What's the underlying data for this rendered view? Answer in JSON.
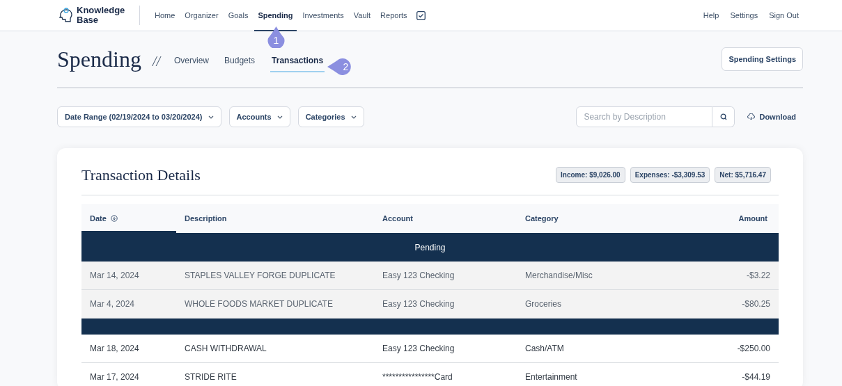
{
  "brand": {
    "name": "Knowledge Base"
  },
  "nav": {
    "items": [
      {
        "label": "Home",
        "selected": false
      },
      {
        "label": "Organizer",
        "selected": false
      },
      {
        "label": "Goals",
        "selected": false
      },
      {
        "label": "Spending",
        "selected": true
      },
      {
        "label": "Investments",
        "selected": false
      },
      {
        "label": "Vault",
        "selected": false
      },
      {
        "label": "Reports",
        "selected": false
      }
    ],
    "right": [
      "Help",
      "Settings",
      "Sign Out"
    ]
  },
  "callouts": [
    {
      "number": "1",
      "kind": "up"
    },
    {
      "number": "2",
      "kind": "left"
    }
  ],
  "page": {
    "title": "Spending",
    "separator": "//",
    "tabs": [
      {
        "label": "Overview",
        "selected": false
      },
      {
        "label": "Budgets",
        "selected": false
      },
      {
        "label": "Transactions",
        "selected": true
      }
    ],
    "settings_button": "Spending Settings"
  },
  "filters": [
    {
      "label": "Date Range (02/19/2024 to 03/20/2024)"
    },
    {
      "label": "Accounts"
    },
    {
      "label": "Categories"
    }
  ],
  "search": {
    "placeholder": "Search by Description"
  },
  "download": "Download",
  "card": {
    "title": "Transaction Details",
    "totals": [
      "Income: $9,026.00",
      "Expenses: -$3,309.53",
      "Net: $5,716.47"
    ]
  },
  "table": {
    "columns": [
      {
        "label": "Date",
        "sorted": true
      },
      {
        "label": "Description",
        "sorted": false
      },
      {
        "label": "Account",
        "sorted": false
      },
      {
        "label": "Category",
        "sorted": false
      },
      {
        "label": "Amount",
        "sorted": false
      }
    ],
    "sections": [
      {
        "label": "Pending",
        "kind": "pending",
        "rows": [
          [
            "Mar 14, 2024",
            "STAPLES VALLEY FORGE DUPLICATE",
            "Easy 123 Checking",
            "Merchandise/Misc",
            "-$3.22"
          ],
          [
            "Mar 4, 2024",
            "WHOLE FOODS MARKET DUPLICATE",
            "Easy 123 Checking",
            "Groceries",
            "-$80.25"
          ]
        ]
      },
      {
        "kind": "posted",
        "rows": [
          [
            "Mar 18, 2024",
            "CASH WITHDRAWAL",
            "Easy 123 Checking",
            "Cash/ATM",
            "-$250.00"
          ],
          [
            "Mar 17, 2024",
            "STRIDE RITE",
            "****************Card",
            "Entertainment",
            "-$44.19"
          ]
        ]
      }
    ]
  }
}
